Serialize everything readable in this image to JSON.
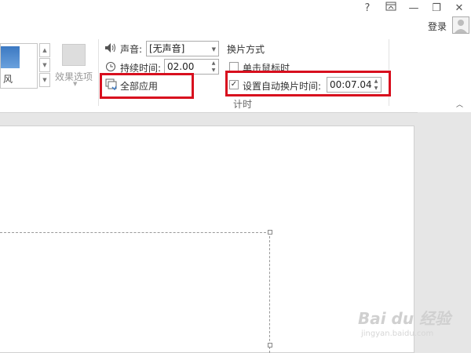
{
  "window_controls": {
    "help": "?",
    "ribbon_display": "⊼",
    "minimize": "—",
    "restore": "❐",
    "close": "✕"
  },
  "account": {
    "login_label": "登录"
  },
  "transitions": {
    "visible_item_label": "风",
    "effect_options_label": "效果选项"
  },
  "timing": {
    "sound_label": "声音:",
    "sound_value": "[无声音]",
    "duration_label": "持续时间:",
    "duration_value": "02.00",
    "apply_all_label": "全部应用",
    "advance_header": "换片方式",
    "on_click_label": "单击鼠标时",
    "on_click_checked": false,
    "auto_advance_label": "设置自动换片时间:",
    "auto_advance_checked": true,
    "auto_advance_value": "00:07.04",
    "group_label": "计时"
  },
  "watermark": {
    "text": "Bai du 经验",
    "sub": "jingyan.baidu.com"
  },
  "colors": {
    "highlight": "#d80f1e",
    "accent": "#3c79c2"
  }
}
